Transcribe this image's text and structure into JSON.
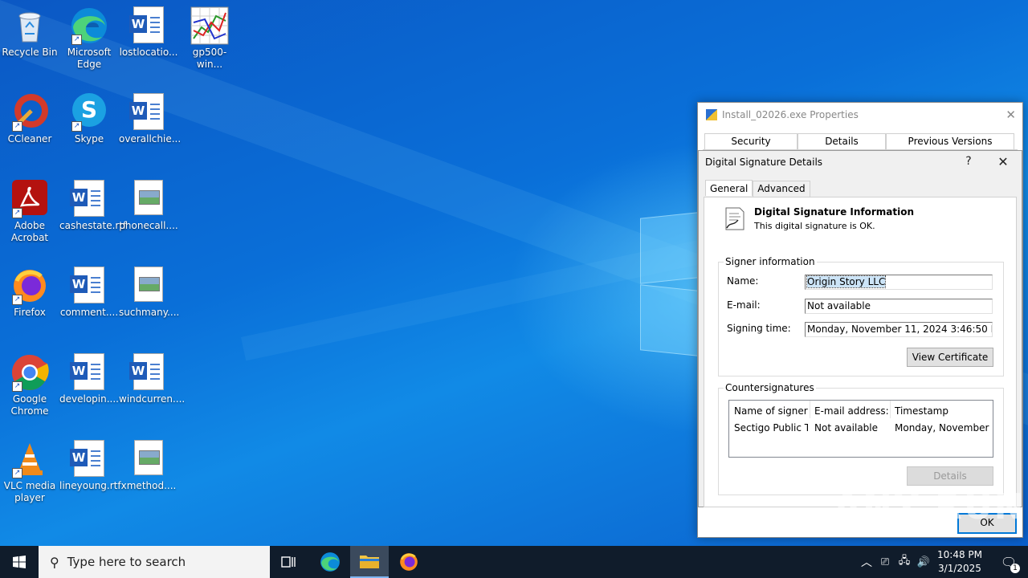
{
  "desktop_icons": [
    {
      "label": "Recycle Bin"
    },
    {
      "label": "Microsoft Edge"
    },
    {
      "label": "lostlocatio..."
    },
    {
      "label": "gp500-win..."
    },
    {
      "label": "CCleaner"
    },
    {
      "label": "Skype"
    },
    {
      "label": "overallchie..."
    },
    {
      "label": "Adobe Acrobat"
    },
    {
      "label": "cashestate.rtf"
    },
    {
      "label": "phonecall...."
    },
    {
      "label": "Firefox"
    },
    {
      "label": "comment...."
    },
    {
      "label": "suchmany...."
    },
    {
      "label": "Google Chrome"
    },
    {
      "label": "developin...."
    },
    {
      "label": "windcurren...."
    },
    {
      "label": "VLC media player"
    },
    {
      "label": "lineyoung.rtf"
    },
    {
      "label": "xmethod...."
    }
  ],
  "properties_window": {
    "title": "Install_02026.exe Properties",
    "tabs": [
      "Security",
      "Details",
      "Previous Versions"
    ]
  },
  "signature_dialog": {
    "title": "Digital Signature Details",
    "help": "?",
    "close": "✕",
    "tabs": [
      "General",
      "Advanced"
    ],
    "info_heading": "Digital Signature Information",
    "info_status": "This digital signature is OK.",
    "signer_group": "Signer information",
    "name_label": "Name:",
    "name_value": "Origin Story LLC",
    "email_label": "E-mail:",
    "email_value": "Not available",
    "time_label": "Signing time:",
    "time_value": "Monday, November 11, 2024 3:46:50 PM",
    "view_cert": "View Certificate",
    "counter_group": "Countersignatures",
    "counter_headers": [
      "Name of signer:",
      "E-mail address:",
      "Timestamp"
    ],
    "counter_rows": [
      [
        "Sectigo Public Ti...",
        "Not available",
        "Monday, November ..."
      ]
    ],
    "details_btn": "Details",
    "ok_btn": "OK"
  },
  "taskbar": {
    "search_placeholder": "Type here to search",
    "time": "10:48 PM",
    "date": "3/1/2025",
    "notification_count": "1"
  },
  "watermark": "ANY RUN"
}
